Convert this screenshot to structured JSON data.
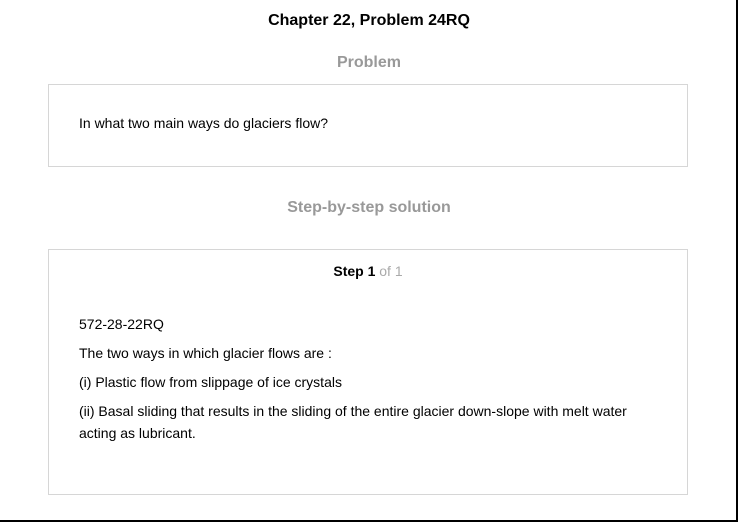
{
  "title": "Chapter 22, Problem 24RQ",
  "problem": {
    "heading": "Problem",
    "text": "In what two main ways do glaciers flow?"
  },
  "solution": {
    "heading": "Step-by-step solution",
    "step_label": "Step 1",
    "step_of": "of 1",
    "lines": [
      "572-28-22RQ",
      "The two ways in which glacier flows are :",
      "(i) Plastic flow from slippage of ice crystals",
      "(ii) Basal sliding that results in the sliding of the entire glacier down-slope with melt water acting as lubricant."
    ]
  }
}
